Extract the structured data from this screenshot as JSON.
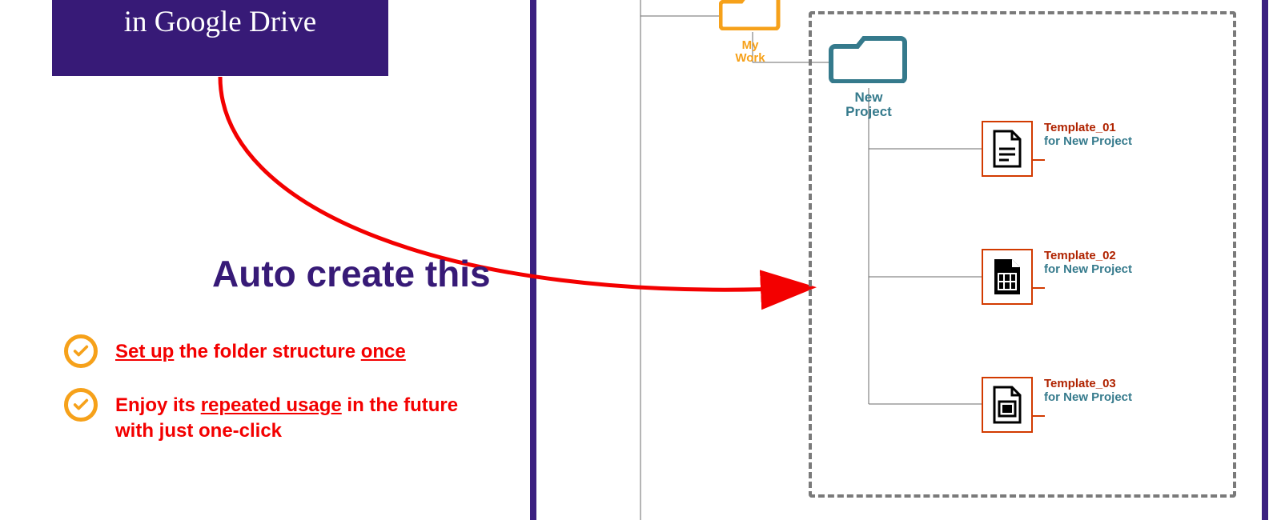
{
  "title_card": "in Google Drive",
  "headline": "Auto create this",
  "bullets": {
    "b1": "Set up the folder structure once",
    "b2": "Enjoy its repeated usage in the future with just one-click"
  },
  "folders": {
    "mywork_line1": "My",
    "mywork_line2": "Work",
    "newproject_line1": "New",
    "newproject_line2": "Project"
  },
  "files": {
    "f1_name": "Template_01",
    "f1_sub": "for New Project",
    "f2_name": "Template_02",
    "f2_sub": "for New Project",
    "f3_name": "Template_03",
    "f3_sub": "for New Project"
  },
  "colors": {
    "purple": "#371a77",
    "orange": "#f6a11a",
    "teal": "#357a8c",
    "red": "#f30000",
    "rust": "#d23a00",
    "grey": "#7a7a7a"
  }
}
